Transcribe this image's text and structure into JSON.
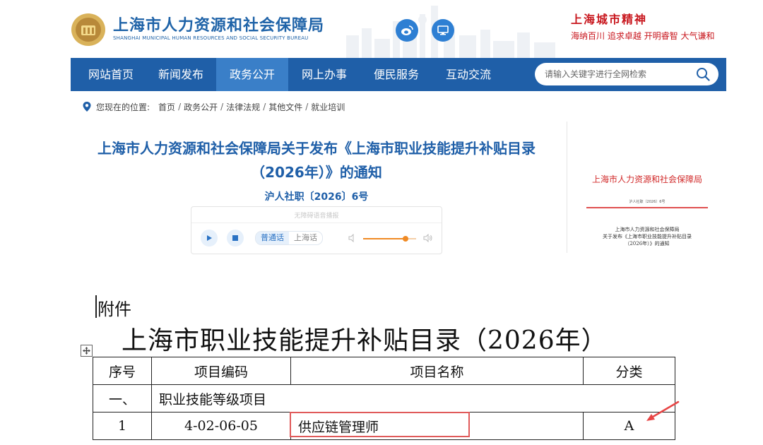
{
  "header": {
    "bureau_name_cn": "上海市人力资源和社会保障局",
    "bureau_name_en": "SHANGHAI MUNICIPAL HUMAN RESOURCES AND SOCIAL SECURITY BUREAU",
    "spirit_title": "上海城市精神",
    "spirit_slogan": "海纳百川 追求卓越 开明睿智 大气谦和"
  },
  "nav": {
    "items": [
      {
        "label": "网站首页"
      },
      {
        "label": "新闻发布"
      },
      {
        "label": "政务公开"
      },
      {
        "label": "网上办事"
      },
      {
        "label": "便民服务"
      },
      {
        "label": "互动交流"
      }
    ],
    "active_index": 2,
    "search_placeholder": "请输入关键字进行全网检索"
  },
  "breadcrumb": {
    "prefix": "您现在的位置:",
    "items": [
      "首页",
      "政务公开",
      "法律法规",
      "其他文件",
      "就业培训"
    ]
  },
  "article": {
    "title": "上海市人力资源和社会保障局关于发布《上海市职业技能提升补贴目录 （2026年）》的通知",
    "doc_number": "沪人社职〔2026〕6号"
  },
  "player": {
    "hint": "无障碍语音播报",
    "lang_mandarin": "普通话",
    "lang_shanghainese": "上海话",
    "volume": 0.8
  },
  "preview": {
    "org": "上海市人力资源和社会保障局",
    "num": "沪人社职〔2026〕6号",
    "text_lines": [
      "上海市人力资源和社会保障局",
      "关于发布《上海市职业技能提升补贴目录",
      "（2026年）》的通知"
    ]
  },
  "document": {
    "attachment_label": "附件",
    "catalog_title": "上海市职业技能提升补贴目录（2026年）",
    "table": {
      "headers": [
        "序号",
        "项目编码",
        "项目名称",
        "分类"
      ],
      "section_row": {
        "index": "一、",
        "name": "职业技能等级项目"
      },
      "rows": [
        {
          "no": "1",
          "code": "4-02-06-05",
          "name": "供应链管理师",
          "category": "A"
        }
      ]
    }
  },
  "colors": {
    "brand_blue": "#1f5fa8",
    "nav_active": "#3a7fc8",
    "slogan_red": "#c8161d",
    "highlight_red": "#e05a5a"
  }
}
